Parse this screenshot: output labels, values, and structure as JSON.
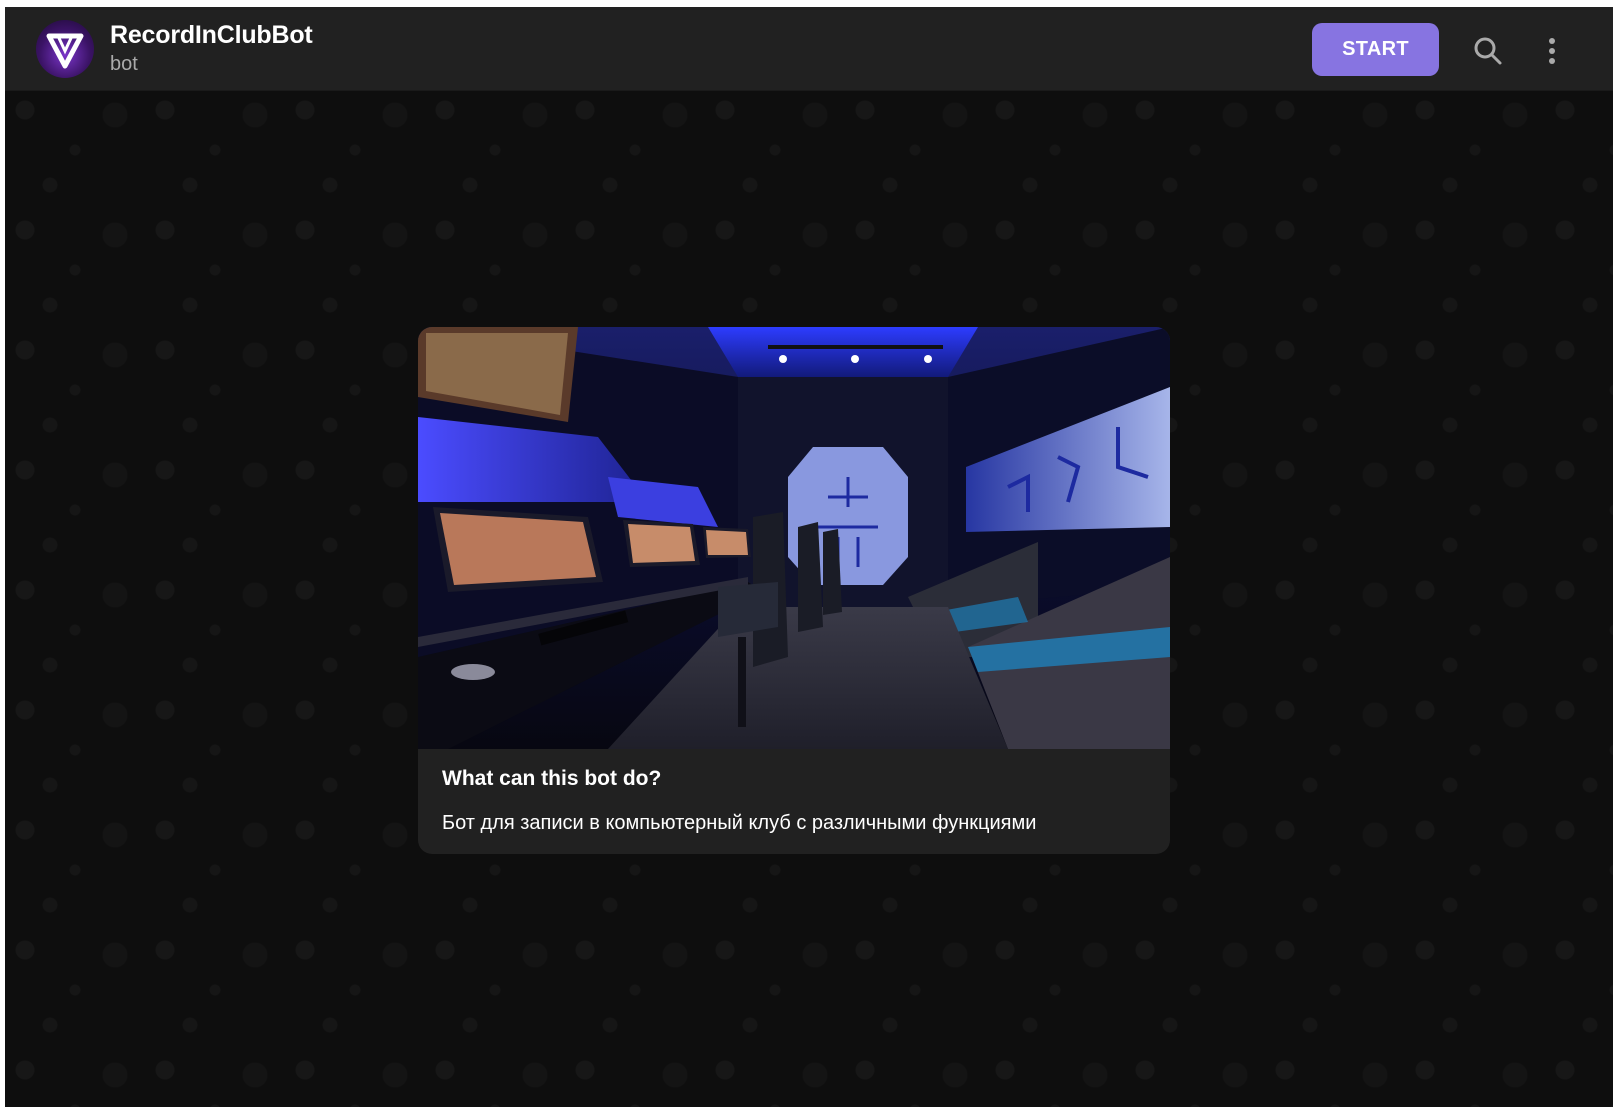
{
  "header": {
    "title": "RecordInClubBot",
    "subtitle": "bot",
    "start_label": "START",
    "avatar_icon": "v-logo-icon",
    "search_icon": "search-icon",
    "more_icon": "more-vertical-icon"
  },
  "card": {
    "image_icon": "gaming-club-photo",
    "title": "What can this bot do?",
    "description": "Бот для записи в компьютерный клуб с различными функциями"
  },
  "colors": {
    "accent": "#8774e1",
    "header_bg": "#212121",
    "chat_bg": "#0f0f0f",
    "card_bg": "#212121"
  }
}
